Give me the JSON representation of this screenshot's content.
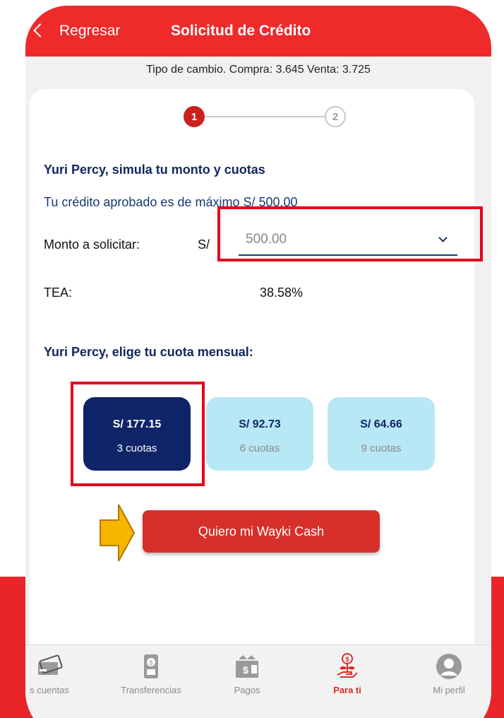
{
  "header": {
    "back_label": "Regresar",
    "title": "Solicitud de Crédito"
  },
  "exchange_rate": "Tipo de cambio. Compra: 3.645 Venta: 3.725",
  "stepper": {
    "step1": "1",
    "step2": "2",
    "current": 1
  },
  "simulation": {
    "heading": "Yuri Percy, simula tu monto y cuotas",
    "approved_text": "Tu crédito aprobado es de máximo S/ 500.00",
    "amount_label": "Monto a solicitar:",
    "currency": "S/",
    "amount_value": "500.00",
    "tea_label": "TEA:",
    "tea_value": "38.58%"
  },
  "quota_section": {
    "heading": "Yuri Percy, elige tu cuota mensual:",
    "options": [
      {
        "amount": "S/ 177.15",
        "count": "3 cuotas",
        "selected": true
      },
      {
        "amount": "S/ 92.73",
        "count": "6 cuotas",
        "selected": false
      },
      {
        "amount": "S/ 64.66",
        "count": "9 cuotas",
        "selected": false
      }
    ]
  },
  "cta_label": "Quiero mi Wayki Cash",
  "tabs": [
    {
      "label": "s cuentas",
      "icon": "cards-icon"
    },
    {
      "label": "Transferencias",
      "icon": "phone-transfer-icon"
    },
    {
      "label": "Pagos",
      "icon": "payments-icon"
    },
    {
      "label": "Para ti",
      "icon": "money-plant-icon",
      "active": true
    },
    {
      "label": "Mi perfil",
      "icon": "profile-icon"
    }
  ],
  "colors": {
    "brand_red": "#ee2a2a",
    "navy": "#0f2468",
    "light_blue": "#b8e8f6",
    "highlight_red": "#e8001c",
    "arrow_yellow": "#f7b500"
  }
}
